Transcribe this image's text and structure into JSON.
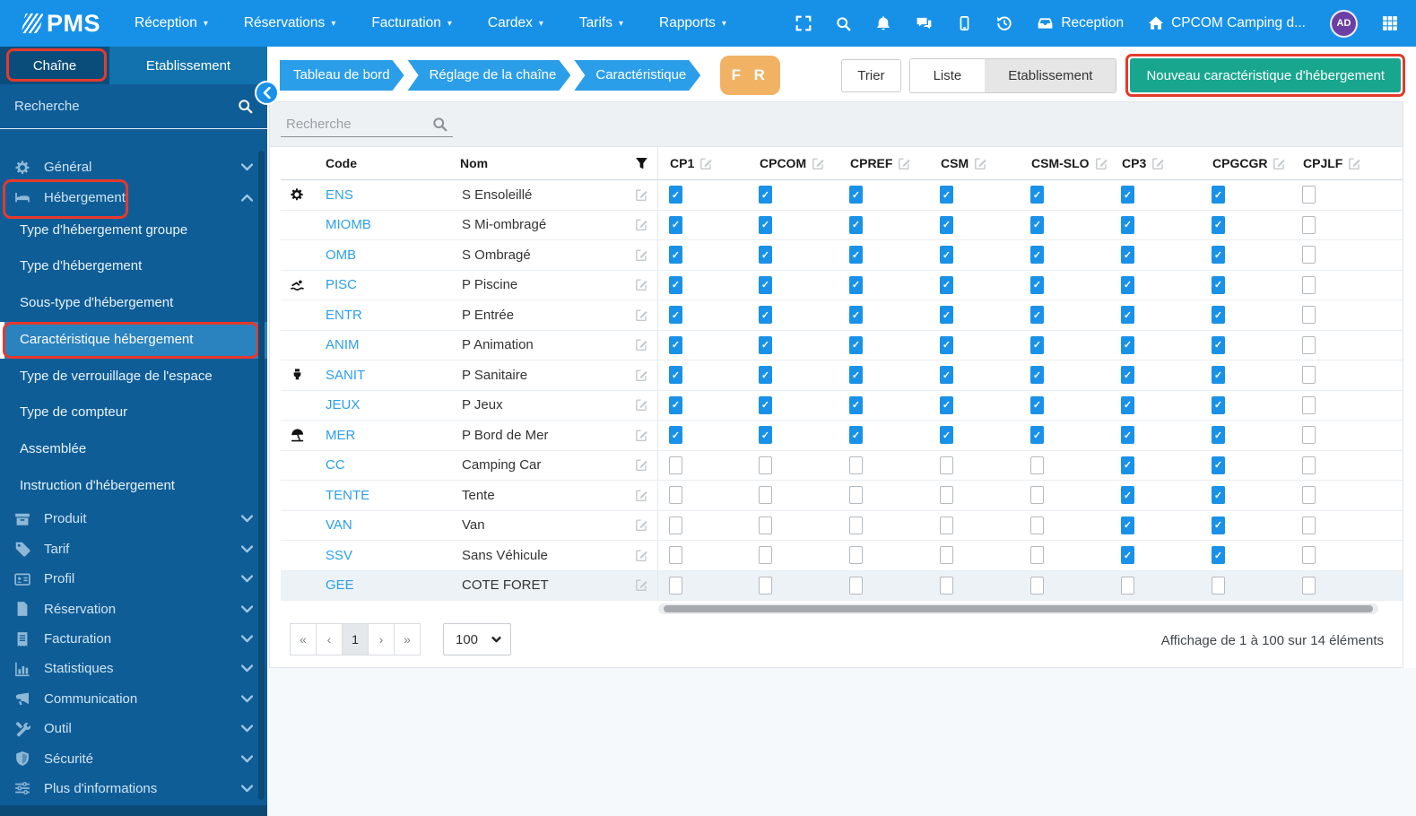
{
  "navbar": {
    "logo": "PMS",
    "menus": [
      {
        "label": "Réception"
      },
      {
        "label": "Réservations"
      },
      {
        "label": "Facturation"
      },
      {
        "label": "Cardex"
      },
      {
        "label": "Tarifs"
      },
      {
        "label": "Rapports"
      }
    ],
    "icon_names": [
      "fullscreen-icon",
      "search-icon",
      "bell-icon",
      "chat-icon",
      "mobile-icon",
      "history-icon"
    ],
    "right": {
      "reception_label": "Reception",
      "property_label": "CPCOM Camping d...",
      "avatar_initials": "AD"
    }
  },
  "sidebar": {
    "tabs": [
      {
        "label": "Chaîne",
        "active": true,
        "highlighted": true
      },
      {
        "label": "Etablissement",
        "active": false
      }
    ],
    "search_placeholder": "Recherche",
    "sections": [
      {
        "label": "Général",
        "icon": "gears-icon",
        "chevron": "down"
      },
      {
        "label": "Hébergement",
        "icon": "bed-icon",
        "chevron": "up",
        "highlighted": true,
        "children": [
          {
            "label": "Type d'hébergement groupe"
          },
          {
            "label": "Type d'hébergement"
          },
          {
            "label": "Sous-type d'hébergement"
          },
          {
            "label": "Caractéristique hébergement",
            "selected": true,
            "highlighted": true
          },
          {
            "label": "Type de verrouillage de l'espace"
          },
          {
            "label": "Type de compteur"
          },
          {
            "label": "Assemblée"
          },
          {
            "label": "Instruction d'hébergement"
          }
        ]
      },
      {
        "label": "Produit",
        "icon": "box-icon",
        "chevron": "down"
      },
      {
        "label": "Tarif",
        "icon": "tag-icon",
        "chevron": "down"
      },
      {
        "label": "Profil",
        "icon": "idcard-icon",
        "chevron": "down"
      },
      {
        "label": "Réservation",
        "icon": "file-icon",
        "chevron": "down"
      },
      {
        "label": "Facturation",
        "icon": "receipt-icon",
        "chevron": "down"
      },
      {
        "label": "Statistiques",
        "icon": "chart-icon",
        "chevron": "down"
      },
      {
        "label": "Communication",
        "icon": "megaphone-icon",
        "chevron": "down"
      },
      {
        "label": "Outil",
        "icon": "tools-icon",
        "chevron": "down"
      },
      {
        "label": "Sécurité",
        "icon": "shield-icon",
        "chevron": "down"
      },
      {
        "label": "Plus d'informations",
        "icon": "sliders-icon",
        "chevron": "down"
      }
    ]
  },
  "breadcrumb": [
    "Tableau de bord",
    "Réglage de la chaîne",
    "Caractéristique"
  ],
  "language_badge": "F R",
  "toolbar": {
    "sort_label": "Trier",
    "view_list_label": "Liste",
    "view_establishment_label": "Etablissement",
    "new_label": "Nouveau caractéristique d'hébergement"
  },
  "panel": {
    "search_placeholder": "Recherche"
  },
  "table": {
    "columns": [
      "Code",
      "Nom"
    ],
    "establishments": [
      "CP1",
      "CPCOM",
      "CPREF",
      "CSM",
      "CSM-SLO",
      "CP3",
      "CPGCGR",
      "CPJLF"
    ],
    "rows": [
      {
        "icon": "gear-icon",
        "code": "ENS",
        "name": "S Ensoleillé",
        "checks": [
          1,
          1,
          1,
          1,
          1,
          1,
          1,
          0
        ]
      },
      {
        "icon": null,
        "code": "MIOMB",
        "name": "S Mi-ombragé",
        "checks": [
          1,
          1,
          1,
          1,
          1,
          1,
          1,
          0
        ]
      },
      {
        "icon": null,
        "code": "OMB",
        "name": "S Ombragé",
        "checks": [
          1,
          1,
          1,
          1,
          1,
          1,
          1,
          0
        ]
      },
      {
        "icon": "swimmer-icon",
        "code": "PISC",
        "name": "P Piscine",
        "checks": [
          1,
          1,
          1,
          1,
          1,
          1,
          1,
          0
        ]
      },
      {
        "icon": null,
        "code": "ENTR",
        "name": "P Entrée",
        "checks": [
          1,
          1,
          1,
          1,
          1,
          1,
          1,
          0
        ]
      },
      {
        "icon": null,
        "code": "ANIM",
        "name": "P Animation",
        "checks": [
          1,
          1,
          1,
          1,
          1,
          1,
          1,
          0
        ]
      },
      {
        "icon": "toilet-icon",
        "code": "SANIT",
        "name": "P Sanitaire",
        "checks": [
          1,
          1,
          1,
          1,
          1,
          1,
          1,
          0
        ]
      },
      {
        "icon": null,
        "code": "JEUX",
        "name": "P Jeux",
        "checks": [
          1,
          1,
          1,
          1,
          1,
          1,
          1,
          0
        ]
      },
      {
        "icon": "beach-umbrella-icon",
        "code": "MER",
        "name": "P Bord de Mer",
        "checks": [
          1,
          1,
          1,
          1,
          1,
          1,
          1,
          0
        ]
      },
      {
        "icon": null,
        "code": "CC",
        "name": "Camping Car",
        "checks": [
          0,
          0,
          0,
          0,
          0,
          1,
          1,
          0
        ]
      },
      {
        "icon": null,
        "code": "TENTE",
        "name": "Tente",
        "checks": [
          0,
          0,
          0,
          0,
          0,
          1,
          1,
          0
        ]
      },
      {
        "icon": null,
        "code": "VAN",
        "name": "Van",
        "checks": [
          0,
          0,
          0,
          0,
          0,
          1,
          1,
          0
        ]
      },
      {
        "icon": null,
        "code": "SSV",
        "name": "Sans Véhicule",
        "checks": [
          0,
          0,
          0,
          0,
          0,
          1,
          1,
          0
        ]
      },
      {
        "icon": null,
        "code": "GEE",
        "name": "COTE FORET",
        "checks": [
          0,
          0,
          0,
          0,
          0,
          0,
          0,
          0
        ],
        "highlighted": true
      }
    ]
  },
  "pagination": {
    "first": "«",
    "prev": "‹",
    "page": "1",
    "next": "›",
    "last": "»",
    "page_size": "100",
    "info": "Affichage de 1 à 100 sur 14 éléments"
  },
  "icons": {
    "fullscreen-icon": "expand corners",
    "search-icon": "magnifier",
    "bell-icon": "notification bell",
    "chat-icon": "chat bubbles",
    "mobile-icon": "mobile device",
    "history-icon": "clock with undo arrow",
    "tray-icon": "reception tray",
    "home-icon": "house",
    "grid-icon": "app grid 3x3",
    "gears-icon": "settings gears",
    "bed-icon": "bed",
    "box-icon": "product box",
    "tag-icon": "price tag",
    "idcard-icon": "profile id card",
    "file-icon": "document",
    "receipt-icon": "invoice receipt",
    "chart-icon": "bar chart",
    "megaphone-icon": "megaphone",
    "tools-icon": "crossed tools",
    "shield-icon": "security shield",
    "sliders-icon": "option sliders",
    "funnel-icon": "filter funnel",
    "edit-icon": "pencil in square",
    "gear-icon": "gear",
    "swimmer-icon": "swimmer in pool",
    "toilet-icon": "toilet",
    "beach-umbrella-icon": "beach umbrella",
    "chevron-down-icon": "chevron down",
    "chevron-up-icon": "chevron up",
    "chevron-left-icon": "chevron left",
    "caret-down-icon": "select caret"
  },
  "colors": {
    "navbar_bg": "#1791e8",
    "sidebar_bg": "#0f5d97",
    "tabbar_bg": "#1172ad",
    "active_tab_bg": "#0b4d7a",
    "selected_item_bg": "#2a82bf",
    "checkbox_blue": "#1a91e8",
    "link_blue": "#2e9fe8",
    "breadcrumb_blue": "#2b9ee9",
    "green_button": "#18a78e",
    "orange_badge": "#f1b264",
    "red_highlight": "#e6392c",
    "avatar_purple": "#6b3fa5"
  }
}
